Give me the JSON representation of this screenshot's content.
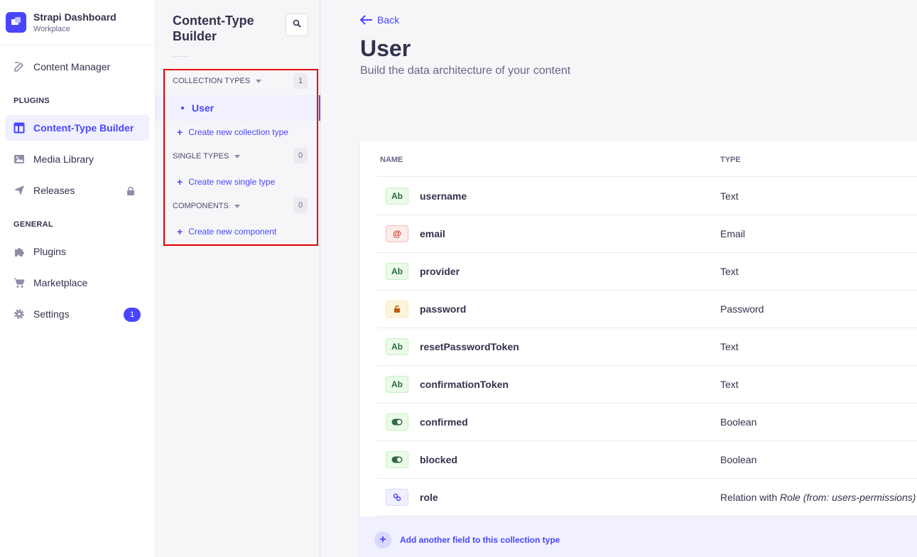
{
  "brand": {
    "title": "Strapi Dashboard",
    "subtitle": "Workplace",
    "icon": "strapi-logo"
  },
  "nav": {
    "content_manager": "Content Manager",
    "plugins_section": "PLUGINS",
    "content_type_builder": "Content-Type Builder",
    "media_library": "Media Library",
    "releases": "Releases",
    "general_section": "GENERAL",
    "plugins": "Plugins",
    "marketplace": "Marketplace",
    "settings": "Settings",
    "settings_badge": "1"
  },
  "subnav": {
    "title": "Content-Type Builder",
    "collection_types": {
      "label": "COLLECTION TYPES",
      "count": "1",
      "items": [
        "User"
      ],
      "create": "Create new collection type"
    },
    "single_types": {
      "label": "SINGLE TYPES",
      "count": "0",
      "create": "Create new single type"
    },
    "components": {
      "label": "COMPONENTS",
      "count": "0",
      "create": "Create new component"
    }
  },
  "main": {
    "back": "Back",
    "title": "User",
    "subtitle": "Build the data architecture of your content",
    "table": {
      "col_name": "NAME",
      "col_type": "TYPE",
      "rows": [
        {
          "icon": "Ab",
          "kind": "text",
          "name": "username",
          "type": "Text"
        },
        {
          "icon": "@",
          "kind": "email",
          "name": "email",
          "type": "Email"
        },
        {
          "icon": "Ab",
          "kind": "text",
          "name": "provider",
          "type": "Text"
        },
        {
          "icon": "lock",
          "kind": "password",
          "name": "password",
          "type": "Password"
        },
        {
          "icon": "Ab",
          "kind": "text",
          "name": "resetPasswordToken",
          "type": "Text"
        },
        {
          "icon": "Ab",
          "kind": "text",
          "name": "confirmationToken",
          "type": "Text"
        },
        {
          "icon": "toggle",
          "kind": "bool",
          "name": "confirmed",
          "type": "Boolean"
        },
        {
          "icon": "toggle",
          "kind": "bool",
          "name": "blocked",
          "type": "Boolean"
        },
        {
          "icon": "link",
          "kind": "relation",
          "name": "role",
          "type": "Relation with ",
          "type_italic": "Role (from: users-permissions)"
        }
      ]
    },
    "add_field": "Add another field to this collection type"
  },
  "colors": {
    "accent": "#4945ff",
    "highlight_border": "#e00000"
  }
}
